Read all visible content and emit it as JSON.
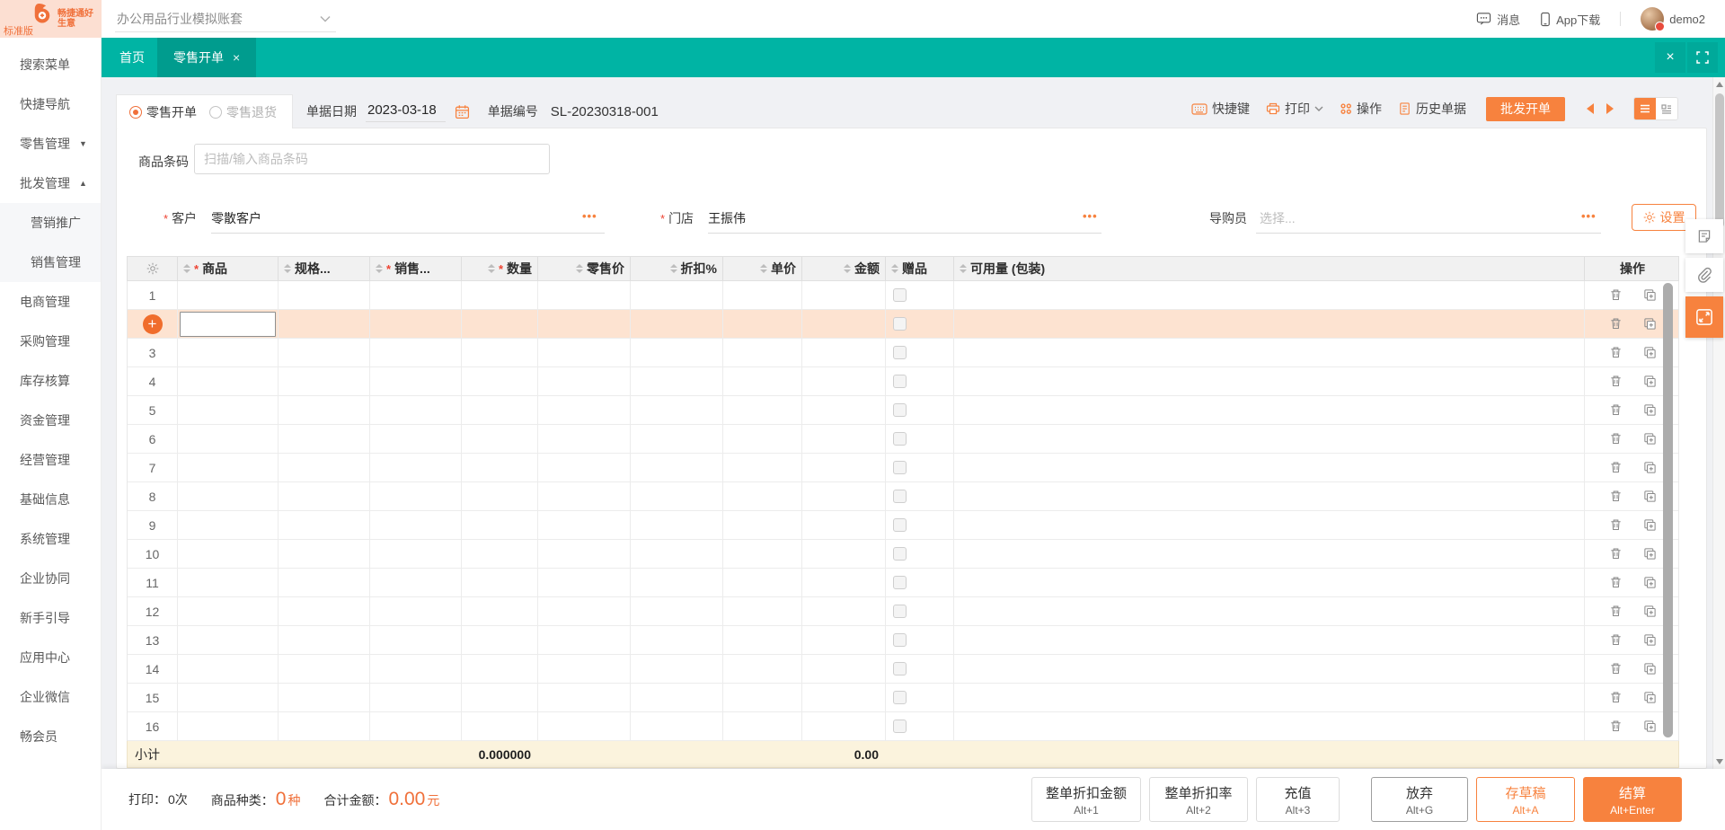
{
  "header": {
    "logo_title": "畅捷通好生意",
    "logo_edition": "标准版",
    "account_set": "办公用品行业模拟账套",
    "messages_label": "消息",
    "app_download_label": "App下载",
    "username": "demo2"
  },
  "tabbar": {
    "tabs": [
      {
        "label": "首页",
        "active": false
      },
      {
        "label": "零售开单",
        "active": true,
        "closable": true
      }
    ]
  },
  "sidebar": {
    "items": [
      {
        "label": "搜索菜单"
      },
      {
        "label": "快捷导航"
      },
      {
        "label": "零售管理",
        "arrow": "down"
      },
      {
        "label": "批发管理",
        "arrow": "up"
      },
      {
        "label": "营销推广",
        "sub": true
      },
      {
        "label": "销售管理",
        "sub": true
      },
      {
        "label": "电商管理"
      },
      {
        "label": "采购管理"
      },
      {
        "label": "库存核算"
      },
      {
        "label": "资金管理"
      },
      {
        "label": "经营管理"
      },
      {
        "label": "基础信息"
      },
      {
        "label": "系统管理"
      },
      {
        "label": "企业协同"
      },
      {
        "label": "新手引导"
      },
      {
        "label": "应用中心"
      },
      {
        "label": "企业微信"
      },
      {
        "label": "畅会员"
      }
    ]
  },
  "bill": {
    "types": [
      {
        "label": "零售开单",
        "selected": true
      },
      {
        "label": "零售退货",
        "selected": false
      }
    ],
    "date_label": "单据日期",
    "date_value": "2023-03-18",
    "number_label": "单据编号",
    "number_value": "SL-20230318-001"
  },
  "toolbar": {
    "shortcut_label": "快捷键",
    "print_label": "打印",
    "actions_label": "操作",
    "history_label": "历史单据",
    "wholesale_label": "批发开单"
  },
  "barcode": {
    "label": "商品条码",
    "placeholder": "扫描/输入商品条码"
  },
  "party": {
    "customer_label": "客户",
    "customer_value": "零散客户",
    "store_label": "门店",
    "store_value": "王振伟",
    "guide_label": "导购员",
    "guide_placeholder": "选择...",
    "settings_label": "设置"
  },
  "table": {
    "row_count": 16,
    "active_row": 2,
    "columns": [
      {
        "label": "",
        "icon": "gear",
        "sort": false,
        "align": "center"
      },
      {
        "label": "商品",
        "required": true,
        "sort": true,
        "align": "left"
      },
      {
        "label": "规格...",
        "sort": true,
        "align": "left"
      },
      {
        "label": "销售...",
        "required": true,
        "sort": true,
        "align": "left"
      },
      {
        "label": "数量",
        "required": true,
        "sort": true,
        "align": "right"
      },
      {
        "label": "零售价",
        "sort": true,
        "align": "right"
      },
      {
        "label": "折扣%",
        "sort": true,
        "align": "right"
      },
      {
        "label": "单价",
        "sort": true,
        "align": "right"
      },
      {
        "label": "金额",
        "sort": true,
        "align": "right"
      },
      {
        "label": "赠品",
        "sort": true,
        "align": "left"
      },
      {
        "label": "可用量 (包装)",
        "sort": true,
        "align": "left"
      },
      {
        "label": "操作",
        "sort": false,
        "align": "center"
      }
    ],
    "subtotal": {
      "label": "小计",
      "quantity": "0.000000",
      "amount": "0.00"
    }
  },
  "footer": {
    "print_label": "打印：",
    "print_value": "0次",
    "kinds_label": "商品种类：",
    "kinds_value": "0",
    "kinds_unit": "种",
    "total_label": "合计金额：",
    "total_value": "0.00",
    "total_unit": "元",
    "buttons": [
      {
        "label": "整单折扣金额",
        "shortcut": "Alt+1",
        "style": "default"
      },
      {
        "label": "整单折扣率",
        "shortcut": "Alt+2",
        "style": "default"
      },
      {
        "label": "充值",
        "shortcut": "Alt+3",
        "style": "default"
      },
      {
        "label": "放弃",
        "shortcut": "Alt+G",
        "style": "cancel"
      },
      {
        "label": "存草稿",
        "shortcut": "Alt+A",
        "style": "outline"
      },
      {
        "label": "结算",
        "shortcut": "Alt+Enter",
        "style": "primary"
      }
    ]
  },
  "colors": {
    "teal": "#00b4a4",
    "teal_active_tab": "#009c8e",
    "accent_orange": "#f7823e",
    "row_highlight": "#fde3d1",
    "subtotal_bg": "#fbf3dd"
  }
}
